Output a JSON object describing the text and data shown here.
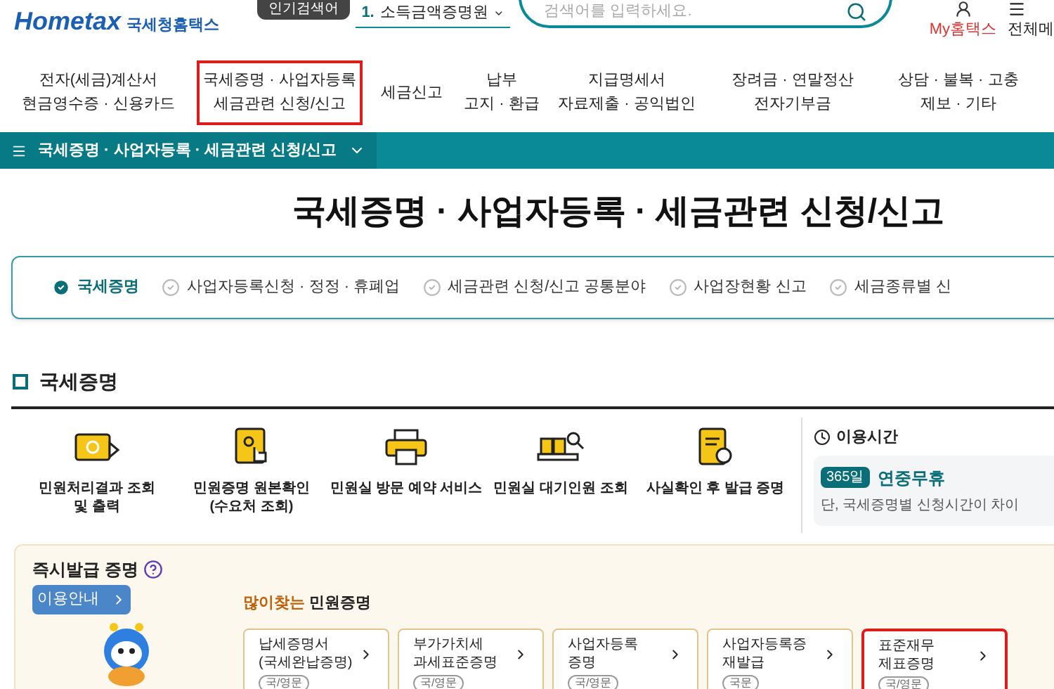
{
  "header": {
    "logo": {
      "brand": "Hometax",
      "name": "국세청홈택스"
    },
    "popular_badge": "인기검색어",
    "popular_search": {
      "rank": "1.",
      "term": "소득금액증명원"
    },
    "search": {
      "placeholder": "검색어를 입력하세요."
    },
    "my_link": "My홈택스",
    "all_menu": "전체메"
  },
  "nav": [
    {
      "lines": [
        "전자(세금)계산서",
        "현금영수증 · 신용카드"
      ],
      "highlighted": false
    },
    {
      "lines": [
        "국세증명 · 사업자등록",
        "세금관련 신청/신고"
      ],
      "highlighted": true
    },
    {
      "lines": [
        "세금신고"
      ],
      "highlighted": false
    },
    {
      "lines": [
        "납부",
        "고지 · 환급"
      ],
      "highlighted": false
    },
    {
      "lines": [
        "지급명세서",
        "자료제출 · 공익법인"
      ],
      "highlighted": false
    },
    {
      "lines": [
        "장려금 · 연말정산",
        "전자기부금"
      ],
      "highlighted": false
    },
    {
      "lines": [
        "상담 · 불복 · 고충",
        "제보 · 기타"
      ],
      "highlighted": false
    }
  ],
  "breadcrumb": "국세증명 · 사업자등록 · 세금관련 신청/신고",
  "page_title": "국세증명 · 사업자등록 · 세금관련 신청/신고",
  "tabs": [
    {
      "label": "국세증명",
      "selected": true
    },
    {
      "label": "사업자등록신청 · 정정 · 휴폐업",
      "selected": false
    },
    {
      "label": "세금관련 신청/신고 공통분야",
      "selected": false
    },
    {
      "label": "사업장현황 신고",
      "selected": false
    },
    {
      "label": "세금종류별 신",
      "selected": false
    }
  ],
  "section_title": "국세증명",
  "services": [
    {
      "kind": "video",
      "lines": [
        "민원처리결과 조회",
        "및 출력"
      ]
    },
    {
      "kind": "scroll",
      "lines": [
        "민원증명 원본확인",
        "(수요처 조회)"
      ]
    },
    {
      "kind": "printer",
      "lines": [
        "민원실 방문 예약 서비스"
      ]
    },
    {
      "kind": "queue",
      "lines": [
        "민원실 대기인원 조회"
      ]
    },
    {
      "kind": "certificate",
      "lines": [
        "사실확인 후 발급 증명"
      ]
    }
  ],
  "hours": {
    "title": "이용시간",
    "badge": "365일",
    "value": "연중무휴",
    "note": "단, 국세증명별 신청시간이 차이"
  },
  "instant": {
    "title": "즉시발급 증명",
    "guide_button": "이용안내",
    "popular": {
      "highlight": "많이찾는",
      "text": "민원증명"
    },
    "cards": [
      {
        "lines": [
          "납세증명서",
          "(국세완납증명)"
        ],
        "tag": "국/영문",
        "highlighted": false
      },
      {
        "lines": [
          "부가가치세",
          "과세표준증명"
        ],
        "tag": "국/영문",
        "highlighted": false
      },
      {
        "lines": [
          "사업자등록",
          "증명"
        ],
        "tag": "국/영문",
        "highlighted": false
      },
      {
        "lines": [
          "사업자등록증",
          "재발급"
        ],
        "tag": "국문",
        "highlighted": false
      },
      {
        "lines": [
          "표준재무",
          "제표증명"
        ],
        "tag": "국/영문",
        "highlighted": true
      }
    ]
  }
}
